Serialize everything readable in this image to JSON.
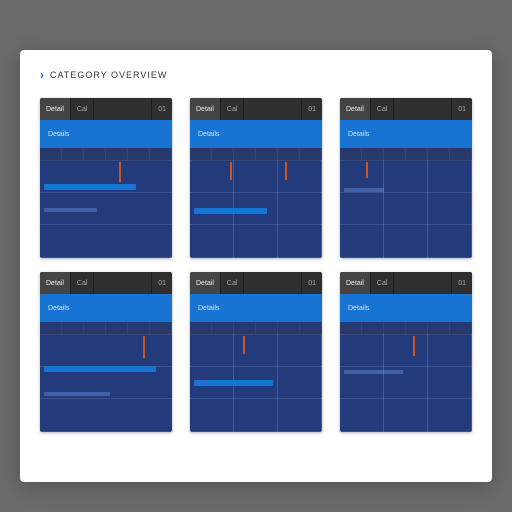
{
  "header": {
    "chevron": "›",
    "title": "Category Overview"
  },
  "cards": [
    {
      "tab_left": "Detail",
      "tab_mid": "Cal",
      "tab_right": "01",
      "banner": "Details"
    },
    {
      "tab_left": "Detail",
      "tab_mid": "Cal",
      "tab_right": "01",
      "banner": "Details"
    },
    {
      "tab_left": "Detail",
      "tab_mid": "Cal",
      "tab_right": "01",
      "banner": "Details"
    },
    {
      "tab_left": "Detail",
      "tab_mid": "Cal",
      "tab_right": "01",
      "banner": "Details"
    },
    {
      "tab_left": "Detail",
      "tab_mid": "Cal",
      "tab_right": "01",
      "banner": "Details"
    },
    {
      "tab_left": "Detail",
      "tab_mid": "Cal",
      "tab_right": "01",
      "banner": "Details"
    }
  ]
}
